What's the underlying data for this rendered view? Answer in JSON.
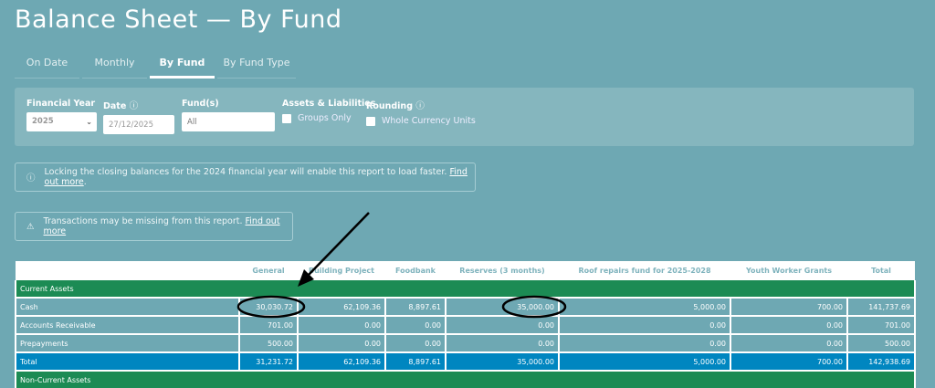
{
  "title": "Balance Sheet — By Fund",
  "tabs": [
    {
      "label": "On Date"
    },
    {
      "label": "Monthly"
    },
    {
      "label": "By Fund",
      "active": true
    },
    {
      "label": "By Fund Type"
    }
  ],
  "filters": {
    "financial_year": {
      "label": "Financial Year",
      "value": "2025"
    },
    "date": {
      "label": "Date",
      "value": "27/12/2025"
    },
    "funds": {
      "label": "Fund(s)",
      "placeholder": "All"
    },
    "assets": {
      "label": "Assets & Liabilities",
      "checkbox": "Groups Only",
      "checked": false
    },
    "rounding": {
      "label": "Rounding",
      "checkbox": "Whole Currency Units",
      "checked": false
    }
  },
  "notices": {
    "lock": {
      "text": "Locking the closing balances for the 2024 financial year will enable this report to load faster.",
      "link": "Find out more",
      "suffix": "."
    },
    "missing": {
      "text": "Transactions may be missing from this report.",
      "link": "Find out more"
    }
  },
  "table": {
    "columns": [
      "",
      "General",
      "Building Project",
      "Foodbank",
      "Reserves (3 months)",
      "Roof repairs fund for 2025-2028",
      "Youth Worker Grants",
      "Total"
    ],
    "sections": [
      {
        "name": "Current Assets",
        "rows": [
          {
            "label": "Cash",
            "values": [
              "30,030.72",
              "62,109.36",
              "8,897.61",
              "35,000.00",
              "5,000.00",
              "700.00",
              "141,737.69"
            ]
          },
          {
            "label": "Accounts Receivable",
            "values": [
              "701.00",
              "0.00",
              "0.00",
              "0.00",
              "0.00",
              "0.00",
              "701.00"
            ]
          },
          {
            "label": "Prepayments",
            "values": [
              "500.00",
              "0.00",
              "0.00",
              "0.00",
              "0.00",
              "0.00",
              "500.00"
            ]
          }
        ],
        "total": {
          "label": "Total",
          "values": [
            "31,231.72",
            "62,109.36",
            "8,897.61",
            "35,000.00",
            "5,000.00",
            "700.00",
            "142,938.69"
          ]
        }
      },
      {
        "name": "Non-Current Assets"
      }
    ]
  },
  "colors": {
    "background": "#6ea8b3",
    "group_row": "#1c8b54",
    "total_row": "#0086c0",
    "filters_panel": "#85b6be"
  }
}
